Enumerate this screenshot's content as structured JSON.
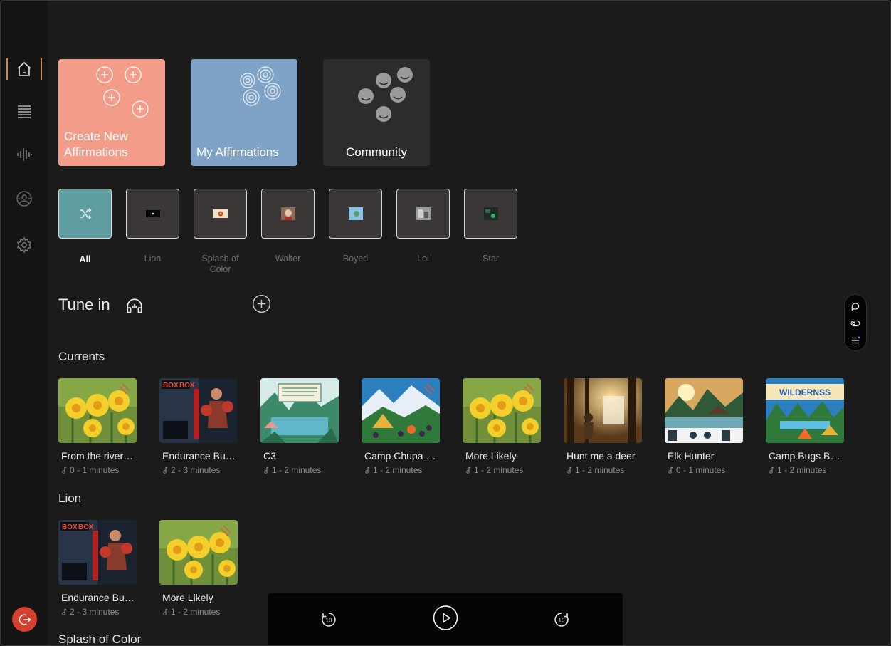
{
  "tiles": [
    {
      "label": "Create New Affirmations",
      "color": "#f39c8a"
    },
    {
      "label": "My Affirmations",
      "color": "#7fa3c6"
    },
    {
      "label": "Community",
      "color": "#2e2b2b"
    }
  ],
  "folders": [
    {
      "label": "All",
      "active": true
    },
    {
      "label": "Lion"
    },
    {
      "label": "Splash of Color"
    },
    {
      "label": "Walter"
    },
    {
      "label": "Boyed"
    },
    {
      "label": "Lol"
    },
    {
      "label": "Star"
    }
  ],
  "tune_in": {
    "title": "Tune in"
  },
  "sections": {
    "currents": {
      "title": "Currents",
      "items": [
        {
          "title": "From the river…",
          "duration": "0 - 1 minutes",
          "art": "daffodil"
        },
        {
          "title": "Endurance Bu…",
          "duration": "2 - 3 minutes",
          "art": "boxer"
        },
        {
          "title": "C3",
          "duration": "1 - 2 minutes",
          "art": "lake"
        },
        {
          "title": "Camp Chupa …",
          "duration": "1 - 2 minutes",
          "art": "camp"
        },
        {
          "title": "More Likely",
          "duration": "1 - 2 minutes",
          "art": "daffodil"
        },
        {
          "title": "Hunt me a deer",
          "duration": "1 - 2 minutes",
          "art": "forest"
        },
        {
          "title": "Elk Hunter",
          "duration": "0 - 1 minutes",
          "art": "elk"
        },
        {
          "title": "Camp Bugs B…",
          "duration": "1 - 2 minutes",
          "art": "wilderness"
        }
      ]
    },
    "lion": {
      "title": "Lion",
      "items": [
        {
          "title": "Endurance Bu…",
          "duration": "2 - 3 minutes",
          "art": "boxer"
        },
        {
          "title": "More Likely",
          "duration": "1 - 2 minutes",
          "art": "daffodil"
        }
      ]
    },
    "splash": {
      "title": "Splash of Color"
    }
  },
  "player": {
    "rewind_label": "10",
    "forward_label": "10"
  },
  "colors": {
    "accent": "#d9834d",
    "logout": "#d6402e",
    "folder_all": "#5f9ea0"
  }
}
